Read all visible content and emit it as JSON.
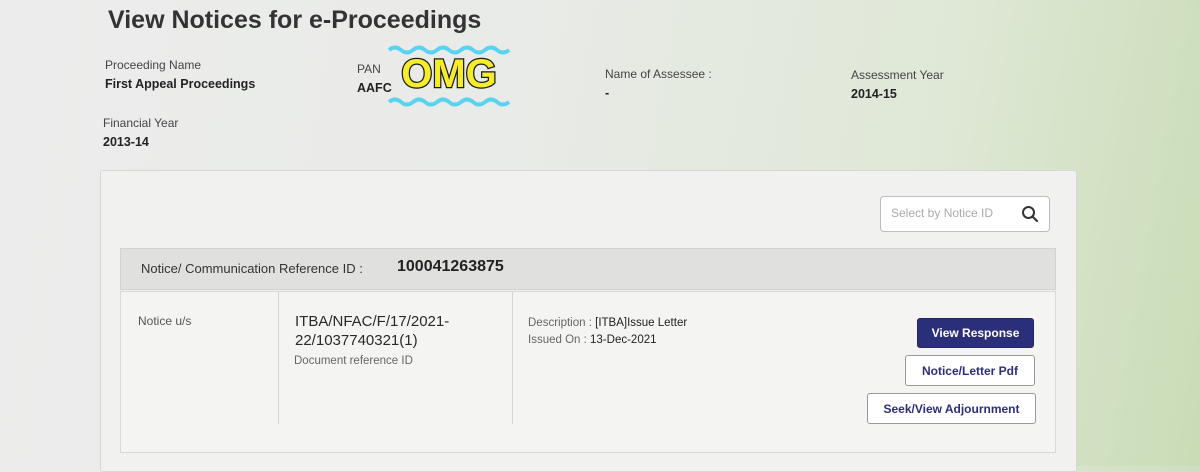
{
  "page": {
    "title": "View Notices for e-Proceedings"
  },
  "details": {
    "proceeding_name": {
      "label": "Proceeding Name",
      "value": "First Appeal Proceedings"
    },
    "pan": {
      "label": "PAN",
      "value": "AAFC"
    },
    "assessee": {
      "label": "Name of Assessee :",
      "value": "-"
    },
    "assessment_year": {
      "label": "Assessment Year",
      "value": "2014-15"
    },
    "financial_year": {
      "label": "Financial Year",
      "value": "2013-14"
    }
  },
  "search": {
    "placeholder": "Select by Notice ID",
    "icon": "search-icon"
  },
  "notice": {
    "ref_label": "Notice/ Communication Reference ID :",
    "ref_id": "100041263875",
    "section_label": "Notice u/s",
    "doc_id_line1": "ITBA/NFAC/F/17/2021-",
    "doc_id_line2": "22/1037740321(1)",
    "doc_id_caption": "Document reference ID",
    "description_label": "Description :",
    "description_value": "[ITBA]Issue Letter",
    "issued_label": "Issued On :",
    "issued_value": "13-Dec-2021"
  },
  "actions": {
    "view_response": "View Response",
    "notice_pdf": "Notice/Letter Pdf",
    "adjournment": "Seek/View Adjournment"
  },
  "sticker": {
    "text": "OMG",
    "fill": "#f5ec2a",
    "wave": "#5bd3f0"
  },
  "colors": {
    "primary": "#2b2f7a"
  }
}
